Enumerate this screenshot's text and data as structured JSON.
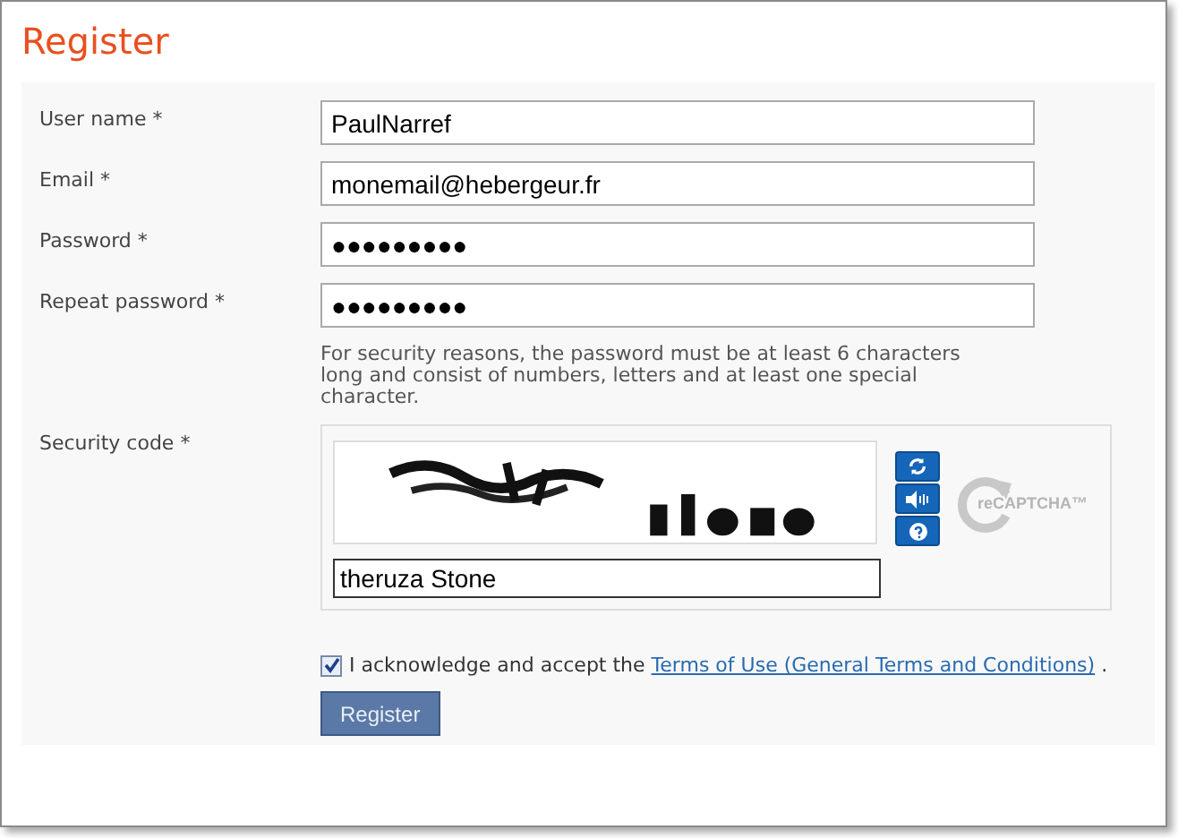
{
  "title": "Register",
  "fields": [
    {
      "label": "User name",
      "required": "*",
      "value": "PaulNarref"
    },
    {
      "label": "Email",
      "required": "*",
      "value": "monemail@hebergeur.fr"
    },
    {
      "label": "Password",
      "required": "*",
      "value": "●●●●●●●●●"
    },
    {
      "label": "Repeat password",
      "required": "*",
      "value": "●●●●●●●●●"
    }
  ],
  "password_hint": "For security reasons, the password must be at least 6 characters long and consist of numbers, letters and at least one special character.",
  "security_code": {
    "label": "Security code",
    "required": "*",
    "value": "theruza Stone",
    "logo": "reCAPTCHA™"
  },
  "terms": {
    "checked": true,
    "text_before": "I acknowledge and accept the",
    "link": "Terms of Use (General Terms and Conditions)",
    "text_after": "."
  },
  "submit": "Register"
}
